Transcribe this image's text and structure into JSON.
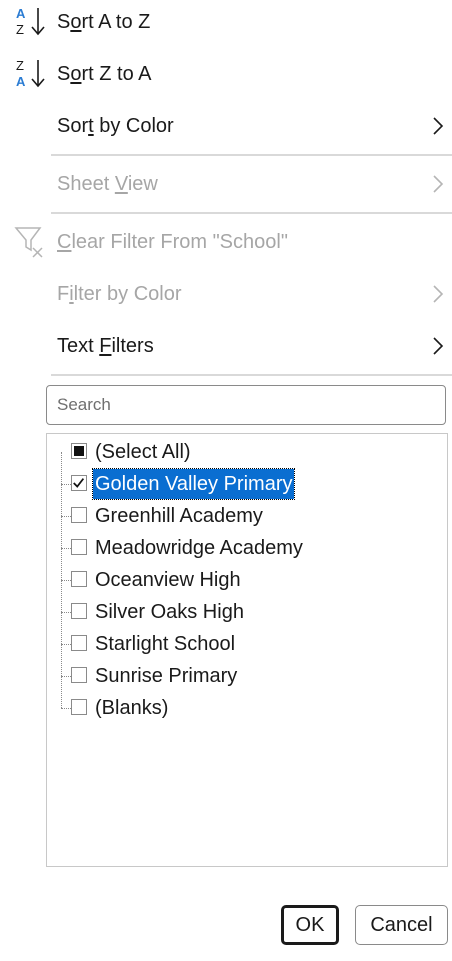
{
  "menu": {
    "sort_az": {
      "pre": "S",
      "ul": "o",
      "post": "rt A to Z",
      "icon": "sort-a-to-z-icon"
    },
    "sort_za": {
      "pre": "S",
      "ul": "o",
      "post": "rt Z to A",
      "icon": "sort-z-to-a-icon"
    },
    "sort_by_color": {
      "pre": "Sor",
      "ul": "t",
      "post": " by Color",
      "has_submenu": true
    },
    "sheet_view": {
      "pre": "Sheet ",
      "ul": "V",
      "post": "iew",
      "disabled": true,
      "has_submenu": true
    },
    "clear_filter": {
      "pre": "",
      "ul": "C",
      "post": "lear Filter From \"School\"",
      "disabled": true,
      "icon": "clear-filter-icon"
    },
    "filter_by_color": {
      "pre": "F",
      "ul": "i",
      "post": "lter by Color",
      "disabled": true,
      "has_submenu": true
    },
    "text_filters": {
      "pre": "Text ",
      "ul": "F",
      "post": "ilters",
      "has_submenu": true
    }
  },
  "search": {
    "placeholder": "Search",
    "value": ""
  },
  "list": {
    "items": [
      {
        "label": "(Select All)",
        "state": "partial"
      },
      {
        "label": "Golden Valley Primary",
        "state": "checked",
        "selected": true
      },
      {
        "label": "Greenhill Academy",
        "state": "unchecked"
      },
      {
        "label": "Meadowridge Academy",
        "state": "unchecked"
      },
      {
        "label": "Oceanview High",
        "state": "unchecked"
      },
      {
        "label": "Silver Oaks High",
        "state": "unchecked"
      },
      {
        "label": "Starlight School",
        "state": "unchecked"
      },
      {
        "label": "Sunrise Primary",
        "state": "unchecked"
      },
      {
        "label": "(Blanks)",
        "state": "unchecked"
      }
    ]
  },
  "buttons": {
    "ok": "OK",
    "cancel": "Cancel"
  },
  "colors": {
    "accent": "#0a6ed1",
    "icon_blue": "#2b7cd3",
    "disabled_text": "#a6a6a6"
  }
}
